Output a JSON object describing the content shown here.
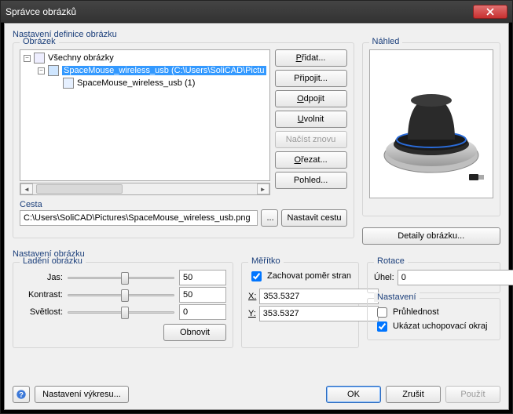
{
  "window": {
    "title": "Správce obrázků"
  },
  "top_label": "Nastavení definice obrázku",
  "obrazek": {
    "group": "Obrázek",
    "tree": {
      "root": "Všechny obrázky",
      "item_selected": "SpaceMouse_wireless_usb  (C:\\Users\\SoliCAD\\Pictu",
      "item_child": "SpaceMouse_wireless_usb (1)"
    },
    "buttons": {
      "pridat": "Přidat...",
      "pripojit": "Připojit...",
      "odpojit": "Odpojit",
      "uvolnit": "Uvolnit",
      "nacist": "Načíst znovu",
      "orezat": "Ořezat...",
      "pohled": "Pohled..."
    }
  },
  "nahled": {
    "group": "Náhled",
    "detaily": "Detaily obrázku..."
  },
  "cesta": {
    "label": "Cesta",
    "value": "C:\\Users\\SoliCAD\\Pictures\\SpaceMouse_wireless_usb.png",
    "ellipsis": "...",
    "nastavit": "Nastavit cestu"
  },
  "nastaveni_obrazku": "Nastavení obrázku",
  "ladeni": {
    "group": "Ladění obrázku",
    "jas": {
      "label": "Jas:",
      "value": "50"
    },
    "kontrast": {
      "label": "Kontrast:",
      "value": "50"
    },
    "svetlost": {
      "label": "Světlost:",
      "value": "0"
    },
    "obnovit": "Obnovit"
  },
  "meritko": {
    "group": "Měřítko",
    "zachovat": "Zachovat poměr stran",
    "x": "353.5327",
    "y": "353.5327"
  },
  "rotace": {
    "group": "Rotace",
    "uhel_label": "Úhel:",
    "uhel": "0"
  },
  "nastaveni": {
    "group": "Nastavení",
    "pruhlednost": "Průhlednost",
    "okraj": "Ukázat uchopovací okraj"
  },
  "footer": {
    "nastaveni_vykresu": "Nastavení výkresu...",
    "ok": "OK",
    "zrusit": "Zrušit",
    "pouzit": "Použít"
  }
}
